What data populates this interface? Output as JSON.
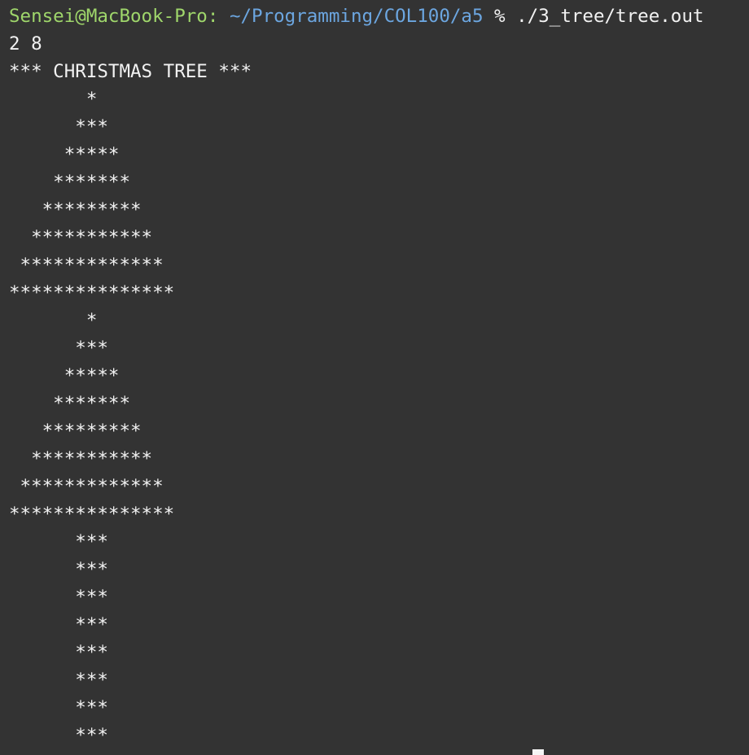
{
  "terminal": {
    "prompt_user_host": "Sensei@MacBook-Pro:",
    "prompt_path": "~/Programming/COL100/a5",
    "prompt_command": " % ./3_tree/tree.out",
    "input_line": "2 8",
    "header_line": "*** CHRISTMAS TREE ***",
    "output_lines": [
      "       *",
      "      ***",
      "     *****",
      "    *******",
      "   *********",
      "  ***********",
      " *************",
      "***************",
      "       *",
      "      ***",
      "     *****",
      "    *******",
      "   *********",
      "  ***********",
      " *************",
      "***************",
      "      ***",
      "      ***",
      "      ***",
      "      ***",
      "      ***",
      "      ***",
      "      ***",
      "      ***"
    ]
  },
  "colors": {
    "background": "#333333",
    "text": "#f2f2f2",
    "prompt_user": "#9fd66b",
    "prompt_path": "#6ca6e0",
    "cursor": "#f5f5f5"
  }
}
